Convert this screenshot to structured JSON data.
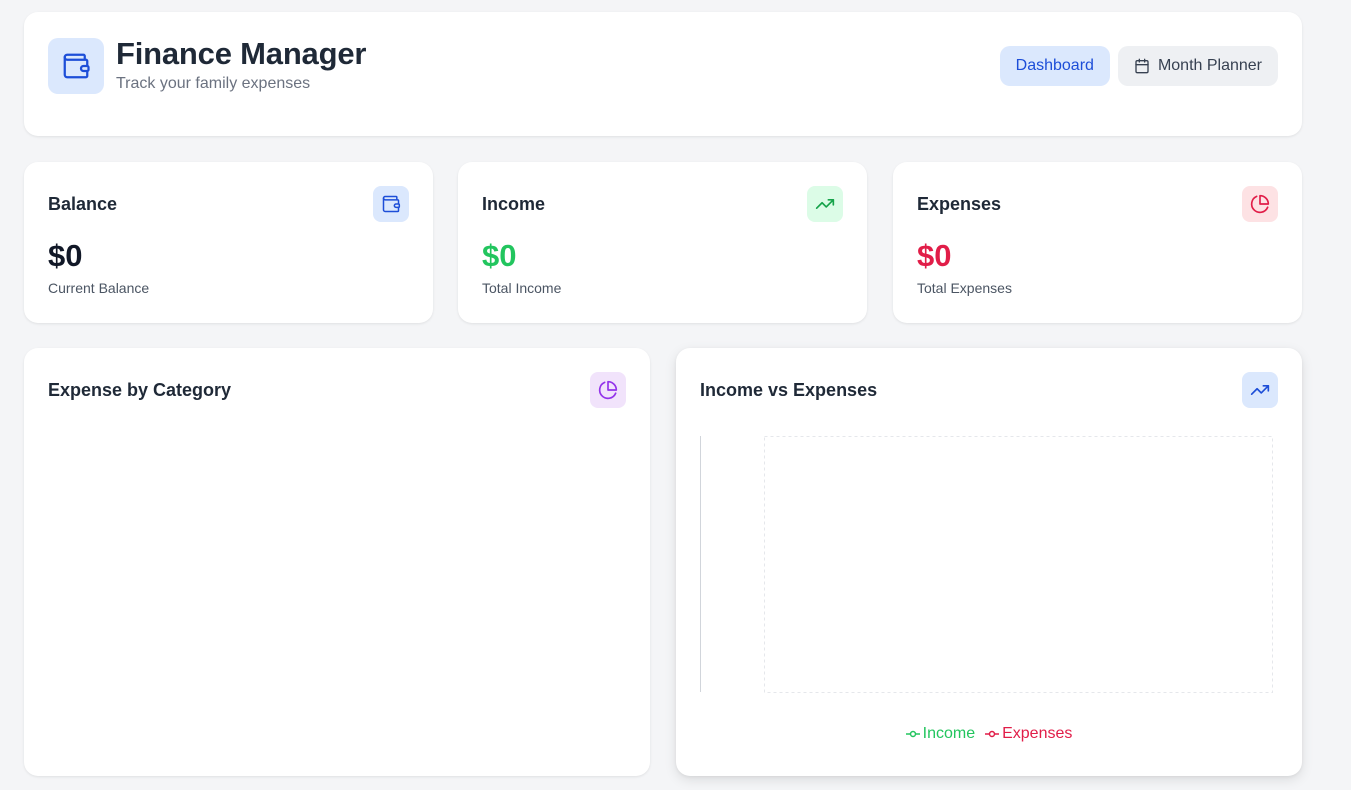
{
  "header": {
    "title": "Finance Manager",
    "subtitle": "Track your family expenses",
    "brand_icon": "wallet-icon",
    "nav": [
      {
        "label": "Dashboard",
        "active": true
      },
      {
        "label": "Month Planner",
        "active": false,
        "icon": "calendar-icon"
      }
    ]
  },
  "stats": {
    "balance": {
      "title": "Balance",
      "value": "$0",
      "label": "Current Balance",
      "icon": "wallet-icon",
      "color": "#111827",
      "icon_bg": "#dbe8fd",
      "icon_color": "#1d4ed8"
    },
    "income": {
      "title": "Income",
      "value": "$0",
      "label": "Total Income",
      "icon": "trending-up-icon",
      "color": "#22c55e",
      "icon_bg": "#dcfce7",
      "icon_color": "#16a34a"
    },
    "expenses": {
      "title": "Expenses",
      "value": "$0",
      "label": "Total Expenses",
      "icon": "pie-chart-icon",
      "color": "#e11d48",
      "icon_bg": "#fde2e4",
      "icon_color": "#e11d48"
    }
  },
  "charts": {
    "category": {
      "title": "Expense by Category",
      "icon": "pie-chart-icon",
      "icon_bg": "#f1e3fb",
      "icon_color": "#9333ea"
    },
    "income_vs_expenses": {
      "title": "Income vs Expenses",
      "icon": "trending-up-icon",
      "icon_bg": "#dbe8fd",
      "icon_color": "#1d4ed8"
    }
  },
  "chart_data": [
    {
      "type": "pie",
      "title": "Expense by Category",
      "categories": [],
      "values": []
    },
    {
      "type": "line",
      "title": "Income vs Expenses",
      "x": [],
      "series": [
        {
          "name": "Income",
          "values": [],
          "color": "#22c55e"
        },
        {
          "name": "Expenses",
          "values": [],
          "color": "#e11d48"
        }
      ],
      "legend": "bottom",
      "grid": true
    }
  ]
}
